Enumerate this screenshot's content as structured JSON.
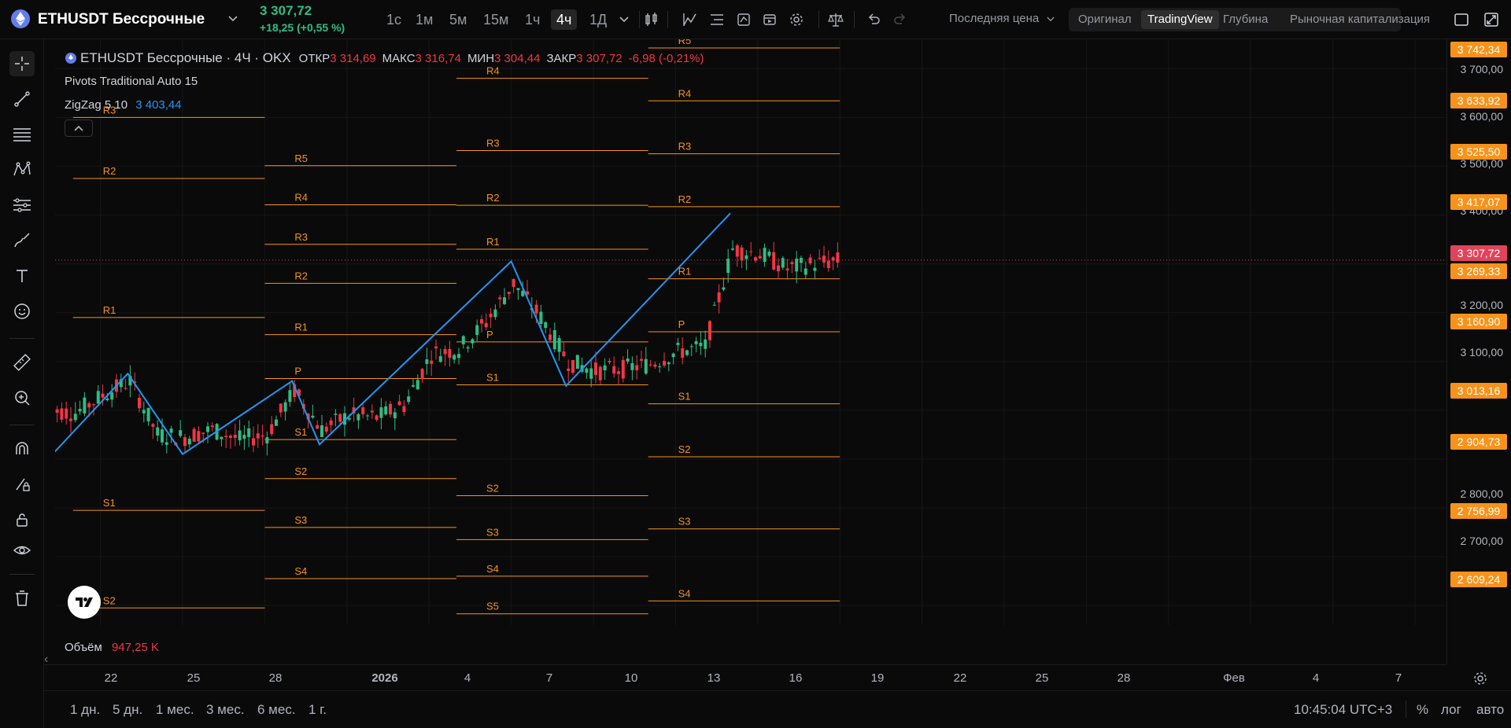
{
  "header": {
    "symbol": "ETHUSDT Бессрочные",
    "price": "3 307,72",
    "change": "+18,25 (+0,55 %)",
    "timeframes": [
      "1с",
      "1м",
      "5м",
      "15м",
      "1ч",
      "4ч",
      "1Д"
    ],
    "active_timeframe": "4ч",
    "price_type": "Последняя цена",
    "views": [
      "Оригинал",
      "TradingView",
      "Глубина",
      "Рыночная капитализация"
    ],
    "active_view": "TradingView"
  },
  "legend": {
    "title": "ETHUSDT Бессрочные · 4Ч · OKX",
    "open_label": "ОТКР",
    "open": "3 314,69",
    "high_label": "МАКС",
    "high": "3 316,74",
    "low_label": "МИН",
    "low": "3 304,44",
    "close_label": "ЗАКР",
    "close": "3 307,72",
    "change": "-6,98 (-0,21%)",
    "pivots": "Pivots Traditional Auto 15",
    "zigzag_label": "ZigZag 5 10",
    "zigzag_value": "3 403,44"
  },
  "volume": {
    "label": "Объём",
    "value": "947,25 K"
  },
  "price_axis": {
    "ticks": [
      "3 700,00",
      "3 600,00",
      "3 500,00",
      "3 400,00",
      "3 200,00",
      "3 100,00",
      "2 800,00",
      "2 700,00"
    ],
    "labels": [
      "3 742,34",
      "3 633,92",
      "3 525,50",
      "3 417,07",
      "3 269,33",
      "3 160,90",
      "3 013,16",
      "2 904,73",
      "2 756,99",
      "2 609,24"
    ],
    "current": "3 307,72"
  },
  "time_axis": [
    "22",
    "25",
    "28",
    "2026",
    "4",
    "7",
    "10",
    "13",
    "16",
    "19",
    "22",
    "25",
    "28",
    "Фев",
    "4",
    "7"
  ],
  "bottom": {
    "ranges": [
      "1 дн.",
      "5 дн.",
      "1 мес.",
      "3 мес.",
      "6 мес.",
      "1 г."
    ],
    "clock": "10:45:04 UTC+3",
    "percent": "%",
    "log": "лог",
    "auto": "авто"
  },
  "colors": {
    "up": "#2ebd85",
    "down": "#f23645",
    "pivot": "#f7931a",
    "zigzag": "#2196f3",
    "current": "#e0435b"
  },
  "chart_data": {
    "type": "candlestick",
    "title": "ETHUSDT Бессрочные · 4Ч · OKX",
    "y_range": [
      2560,
      3760
    ],
    "pivot_periods": [
      {
        "start": "2025-12-21",
        "end": "2025-12-28",
        "levels": [
          {
            "name": "R3",
            "value": 3600
          },
          {
            "name": "R2",
            "value": 3475
          },
          {
            "name": "R1",
            "value": 3190
          },
          {
            "name": "S1",
            "value": 2795
          },
          {
            "name": "S2",
            "value": 2595
          }
        ]
      },
      {
        "start": "2025-12-28",
        "end": "2026-01-04",
        "levels": [
          {
            "name": "R5",
            "value": 3501
          },
          {
            "name": "R4",
            "value": 3421
          },
          {
            "name": "R3",
            "value": 3340
          },
          {
            "name": "R2",
            "value": 3260
          },
          {
            "name": "R1",
            "value": 3155
          },
          {
            "name": "P",
            "value": 3065
          },
          {
            "name": "S1",
            "value": 2940
          },
          {
            "name": "S2",
            "value": 2860
          },
          {
            "name": "S3",
            "value": 2760
          },
          {
            "name": "S4",
            "value": 2655
          }
        ]
      },
      {
        "start": "2026-01-04",
        "end": "2026-01-11",
        "levels": [
          {
            "name": "R4",
            "value": 3680
          },
          {
            "name": "R3",
            "value": 3532
          },
          {
            "name": "R2",
            "value": 3420
          },
          {
            "name": "R1",
            "value": 3330
          },
          {
            "name": "P",
            "value": 3140
          },
          {
            "name": "S1",
            "value": 3052
          },
          {
            "name": "S2",
            "value": 2825
          },
          {
            "name": "S3",
            "value": 2735
          },
          {
            "name": "S4",
            "value": 2660
          },
          {
            "name": "S5",
            "value": 2583
          }
        ]
      },
      {
        "start": "2026-01-11",
        "end": "2026-01-18",
        "levels": [
          {
            "name": "R5",
            "value": 3742.34
          },
          {
            "name": "R4",
            "value": 3633.92
          },
          {
            "name": "R3",
            "value": 3525.5
          },
          {
            "name": "R2",
            "value": 3417.07
          },
          {
            "name": "R1",
            "value": 3269.33
          },
          {
            "name": "P",
            "value": 3160.9
          },
          {
            "name": "S1",
            "value": 3013.16
          },
          {
            "name": "S2",
            "value": 2904.73
          },
          {
            "name": "S3",
            "value": 2756.99
          },
          {
            "name": "S4",
            "value": 2609.24
          }
        ]
      }
    ],
    "zigzag": [
      {
        "x": "2025-12-20",
        "y": 2895
      },
      {
        "x": "2025-12-23",
        "y": 3075
      },
      {
        "x": "2025-12-25",
        "y": 2910
      },
      {
        "x": "2025-12-29",
        "y": 3060
      },
      {
        "x": "2025-12-30",
        "y": 2930
      },
      {
        "x": "2026-01-06",
        "y": 3305
      },
      {
        "x": "2026-01-08",
        "y": 3050
      },
      {
        "x": "2026-01-14",
        "y": 3403.44
      }
    ],
    "close_series": [
      {
        "x": "2025-12-20",
        "y": 3000
      },
      {
        "x": "2025-12-21",
        "y": 2995
      },
      {
        "x": "2025-12-22",
        "y": 3030
      },
      {
        "x": "2025-12-23",
        "y": 3060
      },
      {
        "x": "2025-12-24",
        "y": 2950
      },
      {
        "x": "2025-12-25",
        "y": 2945
      },
      {
        "x": "2025-12-26",
        "y": 2960
      },
      {
        "x": "2025-12-27",
        "y": 2940
      },
      {
        "x": "2025-12-28",
        "y": 2950
      },
      {
        "x": "2025-12-29",
        "y": 3040
      },
      {
        "x": "2025-12-30",
        "y": 2960
      },
      {
        "x": "2025-12-31",
        "y": 2990
      },
      {
        "x": "2026-01-01",
        "y": 2985
      },
      {
        "x": "2026-01-02",
        "y": 3010
      },
      {
        "x": "2026-01-03",
        "y": 3115
      },
      {
        "x": "2026-01-04",
        "y": 3125
      },
      {
        "x": "2026-01-05",
        "y": 3180
      },
      {
        "x": "2026-01-06",
        "y": 3260
      },
      {
        "x": "2026-01-07",
        "y": 3190
      },
      {
        "x": "2026-01-08",
        "y": 3100
      },
      {
        "x": "2026-01-09",
        "y": 3080
      },
      {
        "x": "2026-01-10",
        "y": 3085
      },
      {
        "x": "2026-01-11",
        "y": 3095
      },
      {
        "x": "2026-01-12",
        "y": 3120
      },
      {
        "x": "2026-01-13",
        "y": 3130
      },
      {
        "x": "2026-01-14",
        "y": 3330
      },
      {
        "x": "2026-01-15",
        "y": 3320
      },
      {
        "x": "2026-01-16",
        "y": 3290
      },
      {
        "x": "2026-01-17",
        "y": 3300
      },
      {
        "x": "2026-01-18",
        "y": 3307.72
      }
    ],
    "current_price": 3307.72
  }
}
